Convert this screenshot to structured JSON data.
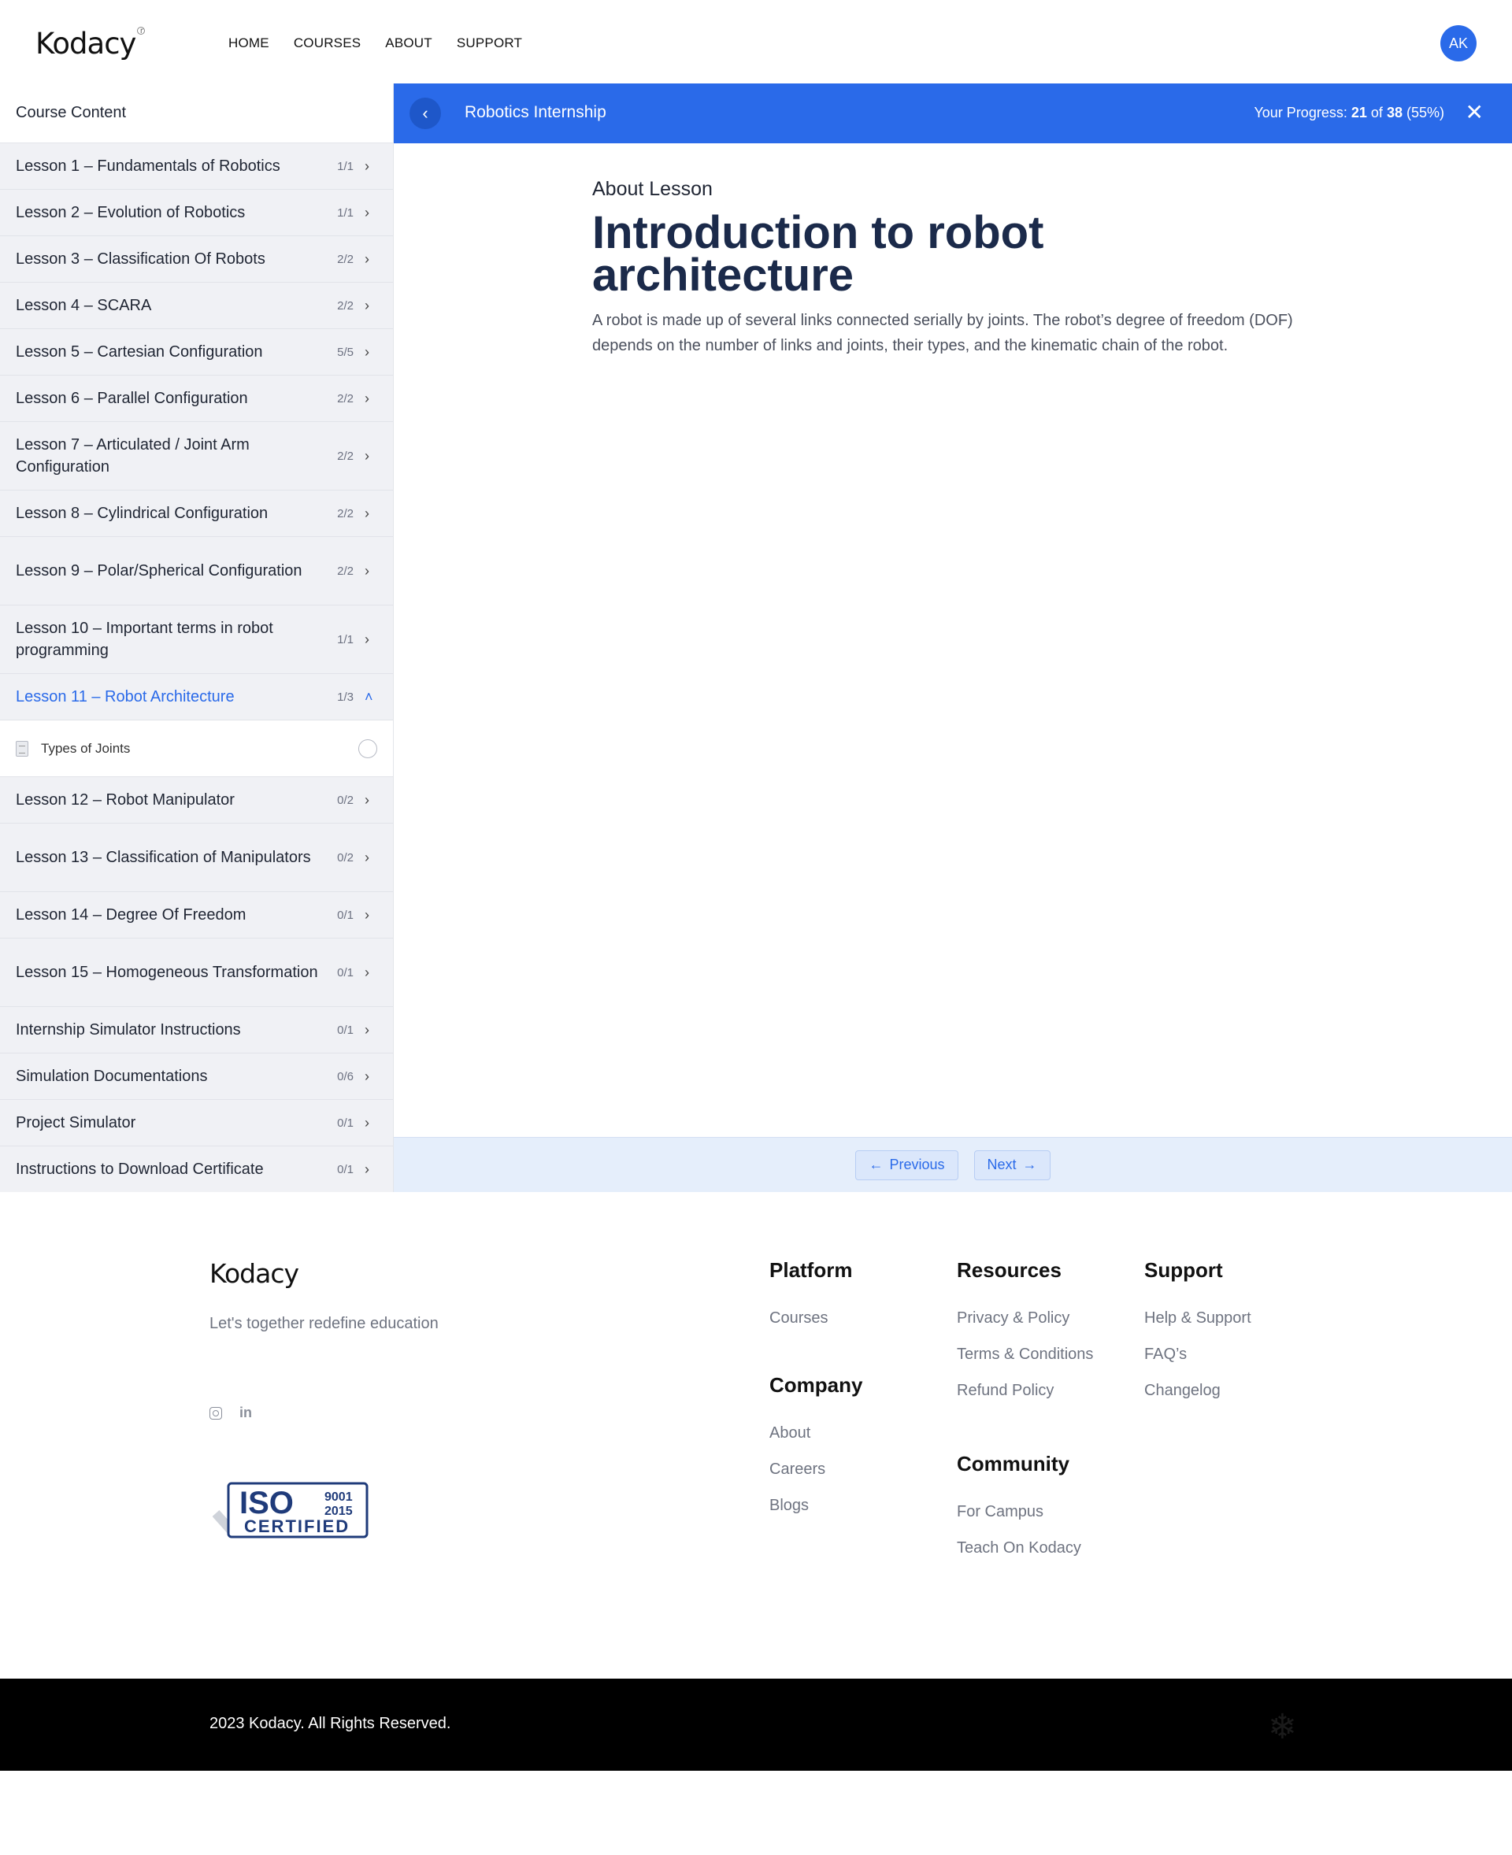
{
  "header": {
    "logo": "Kodacy",
    "nav": [
      "HOME",
      "COURSES",
      "ABOUT",
      "SUPPORT"
    ],
    "avatar_initials": "AK"
  },
  "sidebar": {
    "heading": "Course Content",
    "lessons": [
      {
        "title": "Lesson 1 – Fundamentals of Robotics",
        "count": "1/1"
      },
      {
        "title": "Lesson 2 – Evolution of Robotics",
        "count": "1/1"
      },
      {
        "title": "Lesson 3 – Classification Of Robots",
        "count": "2/2"
      },
      {
        "title": "Lesson 4 – SCARA",
        "count": "2/2"
      },
      {
        "title": "Lesson 5 – Cartesian Configuration",
        "count": "5/5"
      },
      {
        "title": "Lesson 6 – Parallel Configuration",
        "count": "2/2"
      },
      {
        "title": "Lesson 7 – Articulated / Joint Arm Configuration",
        "count": "2/2"
      },
      {
        "title": "Lesson 8 – Cylindrical Configuration",
        "count": "2/2"
      },
      {
        "title": "Lesson 9 – Polar/Spherical Configuration",
        "count": "2/2"
      },
      {
        "title": "Lesson 10 – Important terms in robot programming",
        "count": "1/1"
      },
      {
        "title": "Lesson 11 – Robot Architecture",
        "count": "1/3"
      },
      {
        "title": "Lesson 12 – Robot Manipulator",
        "count": "0/2"
      },
      {
        "title": "Lesson 13 – Classification of Manipulators",
        "count": "0/2"
      },
      {
        "title": "Lesson 14 – Degree Of Freedom",
        "count": "0/1"
      },
      {
        "title": "Lesson 15 – Homogeneous Transformation",
        "count": "0/1"
      },
      {
        "title": "Internship Simulator Instructions",
        "count": "0/1"
      },
      {
        "title": "Simulation Documentations",
        "count": "0/6"
      },
      {
        "title": "Project Simulator",
        "count": "0/1"
      },
      {
        "title": "Instructions to Download Certificate",
        "count": "0/1"
      }
    ],
    "sub_item": "Types of Joints"
  },
  "lesson_bar": {
    "course_name": "Robotics Internship",
    "progress_label": "Your Progress:",
    "progress_done": "21",
    "progress_of": "of",
    "progress_total": "38",
    "progress_pct": "(55%)"
  },
  "content": {
    "eyebrow": "About Lesson",
    "title": "Introduction to robot architecture",
    "description": "A robot is made up of several links connected serially by joints. The robot’s degree of freedom (DOF) depends on the number of links and joints, their types, and the kinematic chain of the robot."
  },
  "pager": {
    "previous": "Previous",
    "next": "Next"
  },
  "footer": {
    "logo": "Kodacy",
    "tagline": "Let's together redefine education",
    "iso": {
      "big": "ISO",
      "year1": "9001",
      "year2": "2015",
      "certified": "CERTIFIED"
    },
    "platform": {
      "heading": "Platform",
      "links": [
        "Courses"
      ]
    },
    "company": {
      "heading": "Company",
      "links": [
        "About",
        "Careers",
        "Blogs"
      ]
    },
    "resources": {
      "heading": "Resources",
      "links": [
        "Privacy & Policy",
        "Terms & Conditions",
        "Refund Policy"
      ]
    },
    "community": {
      "heading": "Community",
      "links": [
        "For Campus",
        "Teach On Kodacy"
      ]
    },
    "support": {
      "heading": "Support",
      "links": [
        "Help & Support",
        "FAQ’s",
        "Changelog"
      ]
    },
    "copyright": "2023 Kodacy. All Rights Reserved."
  },
  "colors": {
    "accent": "#2a6ae9",
    "title": "#1b2a4a",
    "sidebar_bg": "#f0f1f5"
  }
}
